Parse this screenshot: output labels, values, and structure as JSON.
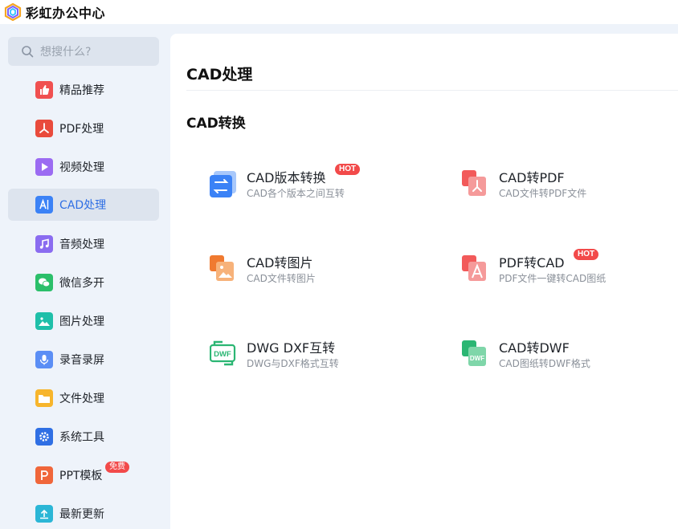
{
  "app": {
    "title": "彩虹办公中心"
  },
  "search": {
    "placeholder": "想搜什么?"
  },
  "sidebar": {
    "items": [
      {
        "label": "精品推荐",
        "icon": "thumbs-up-icon",
        "color": "#f05050"
      },
      {
        "label": "PDF处理",
        "icon": "pdf-icon",
        "color": "#e94b3c"
      },
      {
        "label": "视频处理",
        "icon": "play-icon",
        "color": "#9b6bf2"
      },
      {
        "label": "CAD处理",
        "icon": "cad-icon",
        "color": "#3b82f6",
        "active": true
      },
      {
        "label": "音频处理",
        "icon": "music-icon",
        "color": "#8a6cf0"
      },
      {
        "label": "微信多开",
        "icon": "wechat-icon",
        "color": "#2bbf6a"
      },
      {
        "label": "图片处理",
        "icon": "image-icon",
        "color": "#1fbfa9"
      },
      {
        "label": "录音录屏",
        "icon": "microphone-icon",
        "color": "#5b8ef5"
      },
      {
        "label": "文件处理",
        "icon": "folder-icon",
        "color": "#f7b52c"
      },
      {
        "label": "系统工具",
        "icon": "gear-icon",
        "color": "#2f6fe4"
      },
      {
        "label": "PPT模板",
        "icon": "ppt-icon",
        "color": "#f0663a",
        "badge": "免费"
      },
      {
        "label": "最新更新",
        "icon": "upload-icon",
        "color": "#2bb6d6"
      }
    ]
  },
  "main": {
    "page_title": "CAD处理",
    "section_title": "CAD转换",
    "tools": [
      {
        "name": "CAD版本转换",
        "desc": "CAD各个版本之间互转",
        "badge": "HOT",
        "icon": "version-convert-icon"
      },
      {
        "name": "CAD转PDF",
        "desc": "CAD文件转PDF文件",
        "icon": "cad-to-pdf-icon"
      },
      {
        "name": "CAD转图片",
        "desc": "CAD文件转图片",
        "icon": "cad-to-image-icon"
      },
      {
        "name": "PDF转CAD",
        "desc": "PDF文件一键转CAD图纸",
        "badge": "HOT",
        "icon": "pdf-to-cad-icon"
      },
      {
        "name": "DWG DXF互转",
        "desc": "DWG与DXF格式互转",
        "icon": "dwg-dxf-icon",
        "icon_text": "DWF"
      },
      {
        "name": "CAD转DWF",
        "desc": "CAD图纸转DWF格式",
        "icon": "cad-to-dwf-icon",
        "icon_text": "DWF"
      }
    ]
  }
}
